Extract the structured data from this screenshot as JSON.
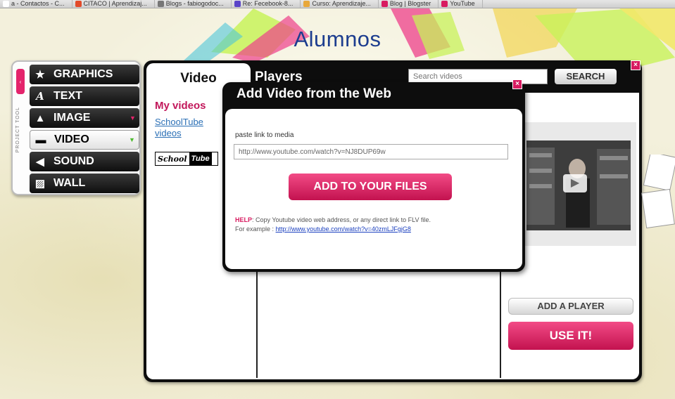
{
  "browser": {
    "tabs": [
      {
        "label": "a - Contactos - C...",
        "color": "#ffffff"
      },
      {
        "label": "CITACO | Aprendizaj...",
        "color": "#e24b2a"
      },
      {
        "label": "Blogs - fabiogodoc...",
        "color": "#777777"
      },
      {
        "label": "Re: Fecebook-8...",
        "color": "#5a44c8"
      },
      {
        "label": "Curso: Aprendizaje...",
        "color": "#e8a83b"
      },
      {
        "label": "Blog | Blogster",
        "color": "#d81b60"
      },
      {
        "label": "YouTube",
        "color": "#d81b60"
      }
    ]
  },
  "header": {
    "title": "Alumnos"
  },
  "toolpanel": {
    "side_label": "PROJECT TOOL",
    "items": [
      {
        "label": "GRAPHICS",
        "icon": "star-icon"
      },
      {
        "label": "TEXT",
        "icon": "text-icon"
      },
      {
        "label": "IMAGE",
        "icon": "image-icon"
      },
      {
        "label": "VIDEO",
        "icon": "video-camera-icon"
      },
      {
        "label": "SOUND",
        "icon": "speaker-icon"
      },
      {
        "label": "WALL",
        "icon": "wall-icon"
      }
    ]
  },
  "main": {
    "tabs": [
      "Video",
      "Players"
    ],
    "search": {
      "placeholder": "Search videos",
      "button": "SEARCH"
    },
    "sources": {
      "my_videos": "My videos",
      "schooltube": "SchoolTube videos"
    },
    "logo": {
      "left": "School",
      "right": "Tube"
    },
    "add_player": "ADD A PLAYER",
    "use_it": "USE IT!"
  },
  "dialog": {
    "title": "Add Video from the Web",
    "label": "paste link to media",
    "url_value": "http://www.youtube.com/watch?v=NJ8DUP69w",
    "button": "ADD TO YOUR FILES",
    "help_key": "HELP",
    "help_text": ": Copy Youtube video web address, or any direct link to FLV file.",
    "example_label": "For example :",
    "example_link": "http://www.youtube.com/watch?v=40zmLJFgjG8"
  },
  "colors": {
    "accent": "#d81b60",
    "title_blue": "#1d3d8f",
    "panel": "#0d0d0d"
  }
}
